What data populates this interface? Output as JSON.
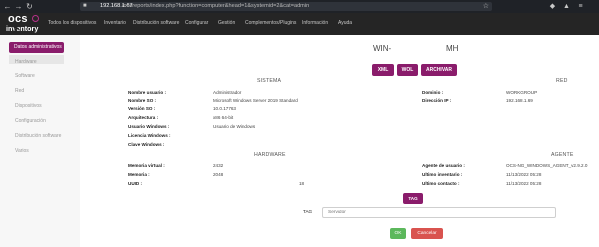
{
  "browser": {
    "url_host": "192.168.1.67",
    "url_path": "/ocsreports/index.php?function=computer&head=1&systemid=2&cat=admin"
  },
  "logo": {
    "line1": "ocs",
    "line2": "inventory"
  },
  "menu": [
    "Todos los dispositivos",
    "Inventario",
    "Distribución software",
    "Configurar",
    "Gestión",
    "Complementos/Plugins",
    "Información",
    "Ayuda"
  ],
  "sidebar": {
    "active": "Datos administrativos",
    "items": [
      "Hardware",
      "Software",
      "Red",
      "Dispositivos",
      "Configuración",
      "Distribución software",
      "Varios"
    ]
  },
  "computer": {
    "name_left": "WIN-",
    "name_right": "MH"
  },
  "actions": {
    "xml": "XML",
    "wol": "WOL",
    "archive": "ARCHIVAR"
  },
  "sections": {
    "system": "SISTEMA",
    "network": "RED",
    "hardware": "HARDWARE",
    "agent": "AGENTE"
  },
  "system_fields": [
    {
      "label": "Nombre usuario :",
      "value": "Administrador"
    },
    {
      "label": "Nombre SO :",
      "value": "Microsoft Windows Server 2019 Standard"
    },
    {
      "label": "Versión SO :",
      "value": "10.0.17763"
    },
    {
      "label": "Arquitectura :",
      "value": "x86 64-bit"
    },
    {
      "label": "Usuario Windows :",
      "value": "Usuario de Windows"
    },
    {
      "label": "Licencia Windows :",
      "value": ""
    },
    {
      "label": "Clave Windows :",
      "value": ""
    }
  ],
  "network_fields": [
    {
      "label": "Dominio :",
      "value": "WORKGROUP"
    },
    {
      "label": "Dirección IP :",
      "value": "192.168.1.69"
    }
  ],
  "hardware_fields": [
    {
      "label": "Memoria virtual :",
      "value": "2432"
    },
    {
      "label": "Memoria :",
      "value": "2048"
    },
    {
      "label": "UUID :",
      "value": "18"
    }
  ],
  "agent_fields": [
    {
      "label": "Agente de usuario :",
      "value": "OCS-NG_WINDOWS_AGENT_v2.9.2.0"
    },
    {
      "label": "Ultimo inventario :",
      "value": "11/13/2022 05:28"
    },
    {
      "label": "Ultimo contacto :",
      "value": "11/13/2022 05:28"
    }
  ],
  "tag": {
    "button": "TAG",
    "label": "TAG",
    "placeholder": "Servidor"
  },
  "form": {
    "ok": "OK",
    "cancel": "Cancelar"
  },
  "colors": {
    "accent": "#8a1c6b",
    "ok": "#5cb85c",
    "cancel": "#d9534f",
    "header": "#252525"
  }
}
